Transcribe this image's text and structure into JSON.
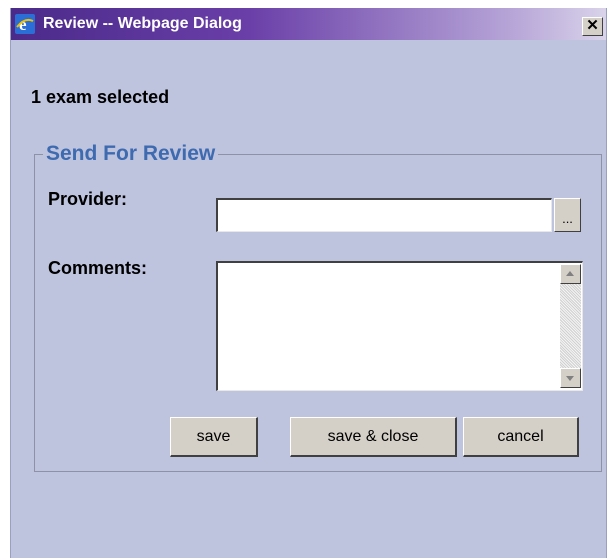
{
  "window": {
    "title": "Review -- Webpage Dialog",
    "close_glyph": "✕",
    "title_icon": "internet-explorer-icon",
    "titlebar_color": "#4a2a8a",
    "background_color": "#bec3de"
  },
  "summary": "1 exam selected",
  "form": {
    "legend": "Send For Review",
    "legend_color": "#3e6ab0",
    "provider": {
      "label": "Provider:",
      "value": "",
      "browse_label": "..."
    },
    "comments": {
      "label": "Comments:",
      "value": ""
    }
  },
  "buttons": {
    "save": "save",
    "save_close": "save & close",
    "cancel": "cancel"
  }
}
